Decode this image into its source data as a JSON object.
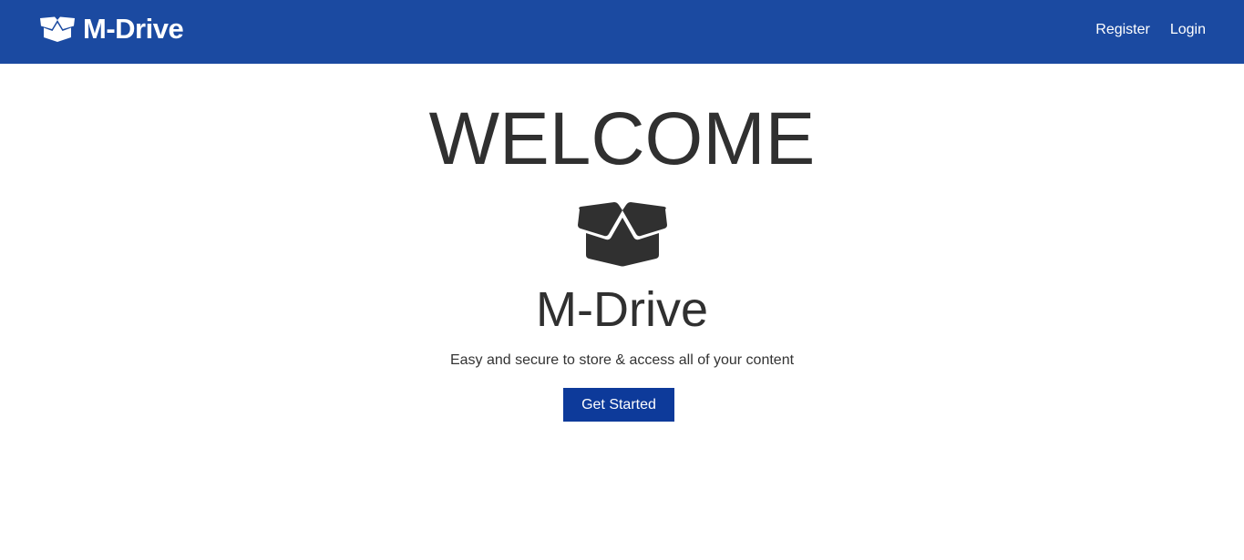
{
  "navbar": {
    "brand": {
      "icon": "box-open-icon",
      "label": "M-Drive"
    },
    "links": [
      {
        "label": "Register"
      },
      {
        "label": "Login"
      }
    ],
    "background_color": "#1b4aa1"
  },
  "hero": {
    "welcome": "WELCOME",
    "icon": "box-open-icon",
    "title": "M-Drive",
    "tagline": "Easy and secure to store & access all of your content",
    "cta_label": "Get Started",
    "cta_color": "#0d3a9a",
    "text_color": "#303030"
  }
}
